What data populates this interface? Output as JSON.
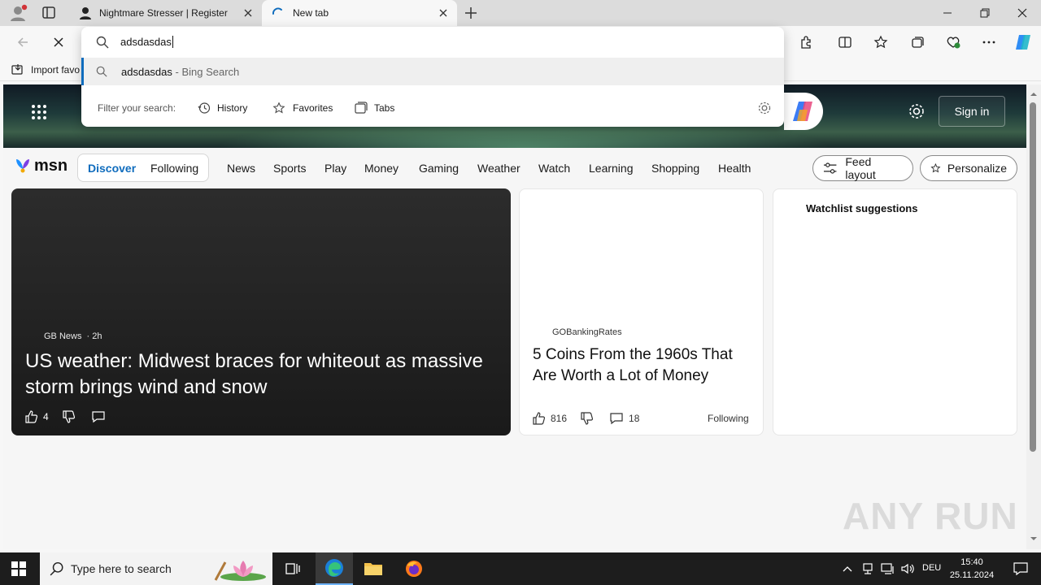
{
  "tabs": [
    {
      "title": "Nightmare Stresser | Register"
    },
    {
      "title": "New tab"
    }
  ],
  "address": {
    "value": "adsdasdas"
  },
  "omnibox": {
    "suggestion_query": "adsdasdas",
    "suggestion_suffix": " - Bing Search",
    "filter_label": "Filter your search:",
    "filters": [
      "History",
      "Favorites",
      "Tabs"
    ]
  },
  "favorites_bar": {
    "import_label": "Import favo"
  },
  "hero": {
    "signin_label": "Sign in"
  },
  "msn": {
    "logo": "msn",
    "feed_tabs": [
      "Discover",
      "Following"
    ],
    "nav_items": [
      "News",
      "Sports",
      "Play",
      "Money",
      "Gaming",
      "Weather",
      "Watch",
      "Learning",
      "Shopping",
      "Health"
    ],
    "feed_layout_label": "Feed layout",
    "personalize_label": "Personalize"
  },
  "cards": [
    {
      "source": "GB News",
      "age": "· 2h",
      "headline": "US weather: Midwest braces for whiteout as massive storm brings wind and snow",
      "likes": "4"
    },
    {
      "source": "GOBankingRates",
      "headline": "5 Coins From the 1960s That Are Worth a Lot of Money",
      "likes": "816",
      "comments": "18",
      "following_label": "Following"
    }
  ],
  "watchlist": {
    "title": "Watchlist suggestions"
  },
  "taskbar": {
    "search_placeholder": "Type here to search",
    "language": "DEU",
    "time": "15:40",
    "date": "25.11.2024"
  },
  "watermark": "ANY RUN",
  "colors": {
    "accent": "#0f6cbd",
    "taskbar": "#1d1d1d"
  }
}
